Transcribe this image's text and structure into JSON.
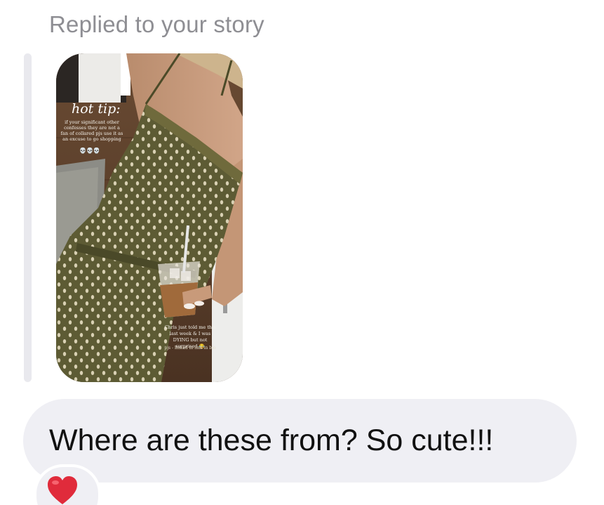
{
  "reply_label": "Replied to your story",
  "story": {
    "title": "hot tip:",
    "body": "if your significant other confesses they are not a fan of collared pjs use it as an excuse to go shopping",
    "emoji_row": "💀💀💀",
    "note": "Chris just told me this last week & I was DYING but not surprised 😂",
    "note2": "pjs - linked in link in bio"
  },
  "message": {
    "text": "Where are these from? So cute!!!",
    "reaction": "heart",
    "reaction_color": "#e02b3b"
  },
  "colors": {
    "label_gray": "#8e8e93",
    "bubble_bg": "#efeff4",
    "quote_bar": "#e9e9ee",
    "jumpsuit_olive": "#5b5a33"
  }
}
